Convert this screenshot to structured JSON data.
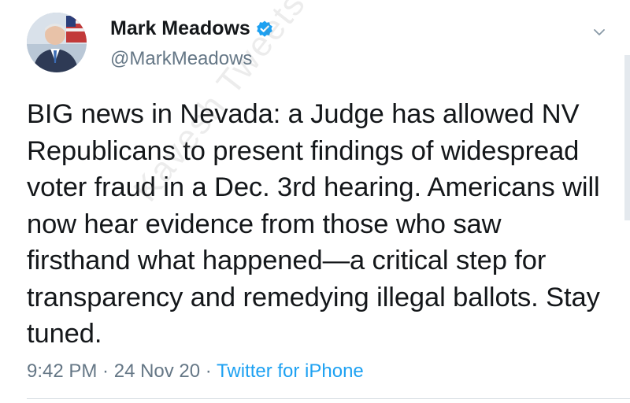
{
  "tweet": {
    "display_name": "Mark Meadows",
    "handle": "@MarkMeadows",
    "text": "BIG news in Nevada: a Judge has allowed NV Republicans to present findings of widespread voter fraud in a Dec. 3rd hearing. Americans will now hear evidence from those who saw firsthand what happened—a critical step for transparency and remedying illegal ballots. Stay tuned.",
    "time": "9:42 PM",
    "separator": " · ",
    "date": "24 Nov 20",
    "source": "Twitter for iPhone"
  },
  "watermark": "Kavesh Tweets",
  "icons": {
    "verified": "verified-badge-icon",
    "menu": "chevron-down-icon"
  },
  "colors": {
    "text": "#14171a",
    "secondary": "#657786",
    "accent": "#1da1f2"
  }
}
